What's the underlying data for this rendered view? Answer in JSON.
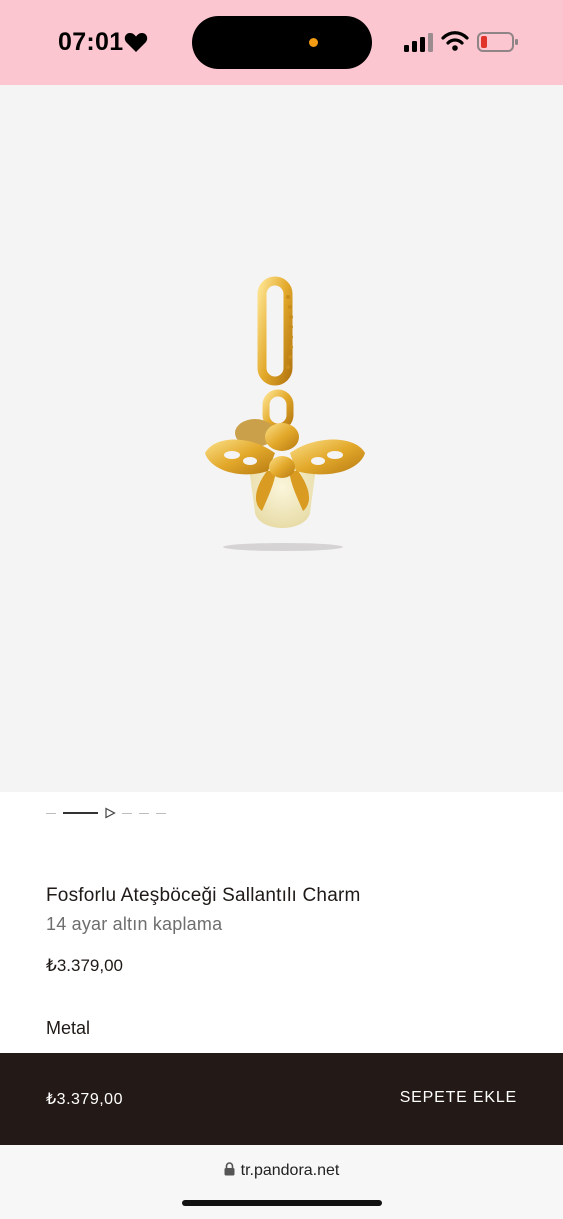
{
  "status_bar": {
    "time": "07:01",
    "background": "#fbc6d0",
    "icons": [
      "heart-icon",
      "signal-icon",
      "wifi-icon",
      "battery-icon"
    ]
  },
  "product": {
    "image_alt_icon": "firefly-charm-image",
    "title": "Fosforlu Ateşböceği Sallantılı Charm",
    "subtitle": "14 ayar altın kaplama",
    "price": "₺3.379,00",
    "metal_label": "Metal"
  },
  "carousel": {
    "slide_count": 5,
    "active_index": 1,
    "control_icon": "play-icon"
  },
  "buy_bar": {
    "price": "₺3.379,00",
    "add_to_cart_label": "SEPETE EKLE",
    "background": "#231916"
  },
  "browser": {
    "url": "tr.pandora.net"
  }
}
